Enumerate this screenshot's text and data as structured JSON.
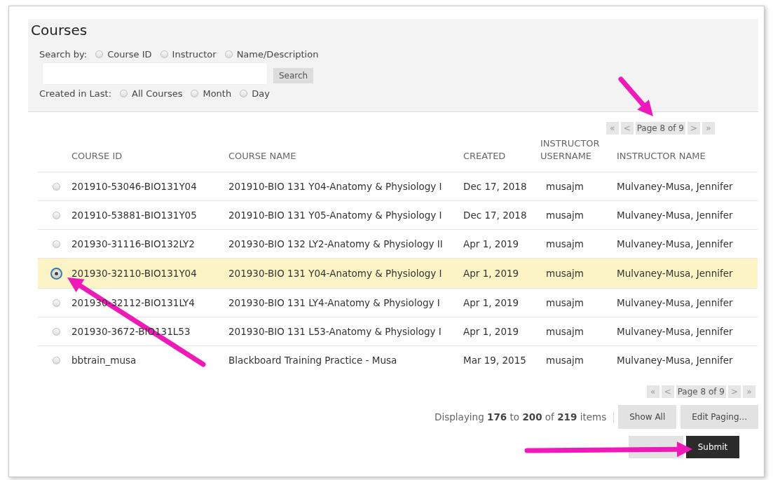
{
  "title": "Courses",
  "search_by": {
    "label": "Search by:",
    "options": [
      {
        "label": "Course ID",
        "selected": false
      },
      {
        "label": "Instructor",
        "selected": false
      },
      {
        "label": "Name/Description",
        "selected": false
      }
    ]
  },
  "search_button": "Search",
  "created_in_last": {
    "label": "Created in Last:",
    "options": [
      {
        "label": "All Courses",
        "selected": false
      },
      {
        "label": "Month",
        "selected": false
      },
      {
        "label": "Day",
        "selected": false
      }
    ]
  },
  "pager_top": {
    "first": "«",
    "prev": "<",
    "label": "Page 8 of 9",
    "next": ">",
    "last": "»"
  },
  "table": {
    "columns": [
      "COURSE ID",
      "COURSE NAME",
      "CREATED",
      "INSTRUCTOR USERNAME",
      "INSTRUCTOR NAME"
    ],
    "rows": [
      {
        "selected": false,
        "cells": [
          "201910-53046-BIO131Y04",
          "201910-BIO 131 Y04-Anatomy & Physiology I",
          "Dec 17, 2018",
          "musajm",
          "Mulvaney-Musa, Jennifer"
        ]
      },
      {
        "selected": false,
        "cells": [
          "201910-53881-BIO131Y05",
          "201910-BIO 131 Y05-Anatomy & Physiology I",
          "Dec 17, 2018",
          "musajm",
          "Mulvaney-Musa, Jennifer"
        ]
      },
      {
        "selected": false,
        "cells": [
          "201930-31116-BIO132LY2",
          "201930-BIO 132 LY2-Anatomy & Physiology II",
          "Apr 1, 2019",
          "musajm",
          "Mulvaney-Musa, Jennifer"
        ]
      },
      {
        "selected": true,
        "cells": [
          "201930-32110-BIO131Y04",
          "201930-BIO 131 Y04-Anatomy & Physiology I",
          "Apr 1, 2019",
          "musajm",
          "Mulvaney-Musa, Jennifer"
        ]
      },
      {
        "selected": false,
        "cells": [
          "201930-32112-BIO131LY4",
          "201930-BIO 131 LY4-Anatomy & Physiology I",
          "Apr 1, 2019",
          "musajm",
          "Mulvaney-Musa, Jennifer"
        ]
      },
      {
        "selected": false,
        "cells": [
          "201930-3672-BIO131L53",
          "201930-BIO 131 L53-Anatomy & Physiology I",
          "Apr 1, 2019",
          "musajm",
          "Mulvaney-Musa, Jennifer"
        ]
      },
      {
        "selected": false,
        "cells": [
          "bbtrain_musa",
          "Blackboard Training Practice - Musa",
          "Mar 19, 2015",
          "musajm",
          "Mulvaney-Musa, Jennifer"
        ]
      }
    ]
  },
  "pager_bottom": {
    "first": "«",
    "prev": "<",
    "label": "Page 8 of 9",
    "next": ">",
    "last": "»"
  },
  "display_text": "Displaying **176** to **200** of **219** items",
  "show_all_button": "Show All",
  "edit_paging_button": "Edit Paging...",
  "submit_button": "Submit"
}
